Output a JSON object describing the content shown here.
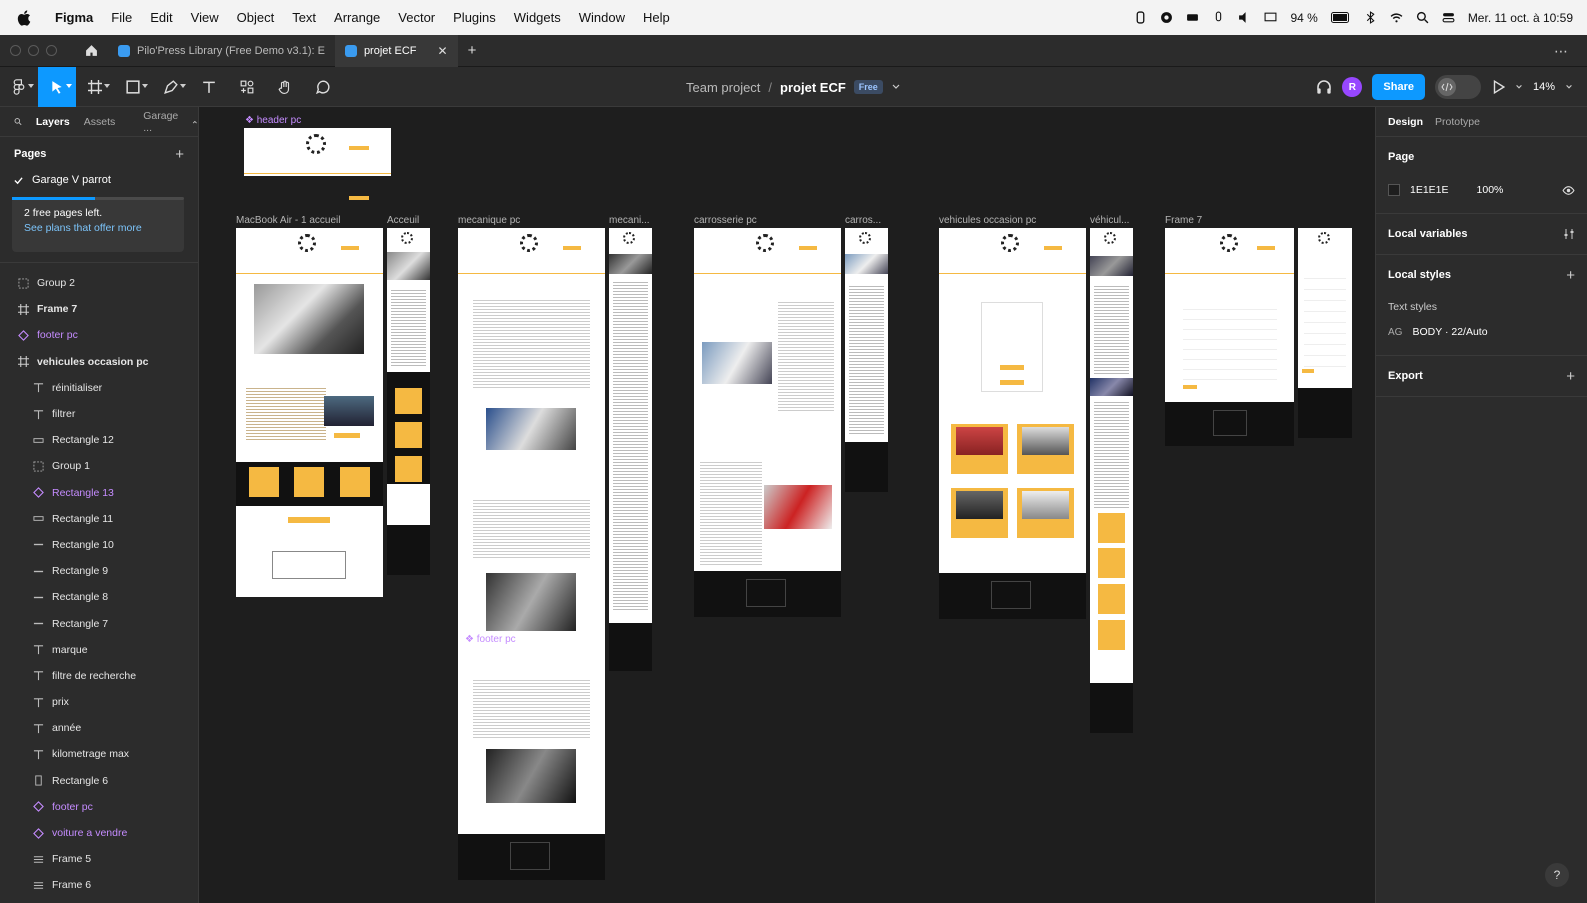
{
  "menubar": {
    "items": [
      "Figma",
      "File",
      "Edit",
      "View",
      "Object",
      "Text",
      "Arrange",
      "Vector",
      "Plugins",
      "Widgets",
      "Window",
      "Help"
    ],
    "battery": "94 %",
    "datetime": "Mer. 11 oct. à 10:59"
  },
  "tabs": [
    {
      "label": "Pilo'Press Library (Free Demo v3.1): E"
    },
    {
      "label": "projet ECF"
    }
  ],
  "breadcrumb": {
    "team": "Team project",
    "sep": "/",
    "file": "projet ECF",
    "badge": "Free"
  },
  "toolbar": {
    "avatar": "R",
    "share": "Share",
    "zoom": "14%"
  },
  "left": {
    "tabs": [
      "Layers",
      "Assets",
      "Garage ..."
    ],
    "pages_title": "Pages",
    "current_page": "Garage V parrot",
    "promo_text": "2 free pages left.",
    "promo_link": "See plans that offer more",
    "layers": [
      {
        "name": "Group 2",
        "kind": "group",
        "depth": 0
      },
      {
        "name": "Frame 7",
        "kind": "frame",
        "depth": 0
      },
      {
        "name": "footer pc",
        "kind": "component",
        "depth": 0
      },
      {
        "name": "vehicules occasion pc",
        "kind": "frame",
        "depth": 0
      },
      {
        "name": "réinitialiser",
        "kind": "text",
        "depth": 1
      },
      {
        "name": "filtrer",
        "kind": "text",
        "depth": 1
      },
      {
        "name": "Rectangle 12",
        "kind": "rect",
        "depth": 1
      },
      {
        "name": "Group 1",
        "kind": "group",
        "depth": 1
      },
      {
        "name": "Rectangle 13",
        "kind": "component",
        "depth": 1
      },
      {
        "name": "Rectangle 11",
        "kind": "rect",
        "depth": 1
      },
      {
        "name": "Rectangle 10",
        "kind": "line",
        "depth": 1
      },
      {
        "name": "Rectangle 9",
        "kind": "line",
        "depth": 1
      },
      {
        "name": "Rectangle 8",
        "kind": "line",
        "depth": 1
      },
      {
        "name": "Rectangle 7",
        "kind": "line",
        "depth": 1
      },
      {
        "name": "marque",
        "kind": "text",
        "depth": 1
      },
      {
        "name": "filtre de recherche",
        "kind": "text",
        "depth": 1
      },
      {
        "name": "prix",
        "kind": "text",
        "depth": 1
      },
      {
        "name": "année",
        "kind": "text",
        "depth": 1
      },
      {
        "name": "kilometrage max",
        "kind": "text",
        "depth": 1
      },
      {
        "name": "Rectangle 6",
        "kind": "vrect",
        "depth": 1
      },
      {
        "name": "footer pc",
        "kind": "component",
        "depth": 1
      },
      {
        "name": "voiture a vendre",
        "kind": "component",
        "depth": 1
      },
      {
        "name": "Frame 5",
        "kind": "list",
        "depth": 1
      },
      {
        "name": "Frame 6",
        "kind": "list",
        "depth": 1
      }
    ]
  },
  "canvas": {
    "labels": {
      "header": "header pc",
      "macbook": "MacBook Air - 1 accueil",
      "acceuil": "Acceuil",
      "mecanique": "mecanique pc",
      "mecani_short": "mecani...",
      "carrosserie": "carrosserie pc",
      "carros_short": "carros...",
      "vehicules": "vehicules occasion pc",
      "vehicul_short": "véhicul...",
      "frame7": "Frame 7",
      "footer": "footer pc"
    }
  },
  "right": {
    "tabs": [
      "Design",
      "Prototype"
    ],
    "page_title": "Page",
    "bg_hex": "1E1E1E",
    "bg_opacity": "100%",
    "local_variables": "Local variables",
    "local_styles": "Local styles",
    "text_styles": "Text styles",
    "text_style_name": "BODY · 22/Auto",
    "text_style_glyph": "AG",
    "export": "Export",
    "help": "?"
  }
}
